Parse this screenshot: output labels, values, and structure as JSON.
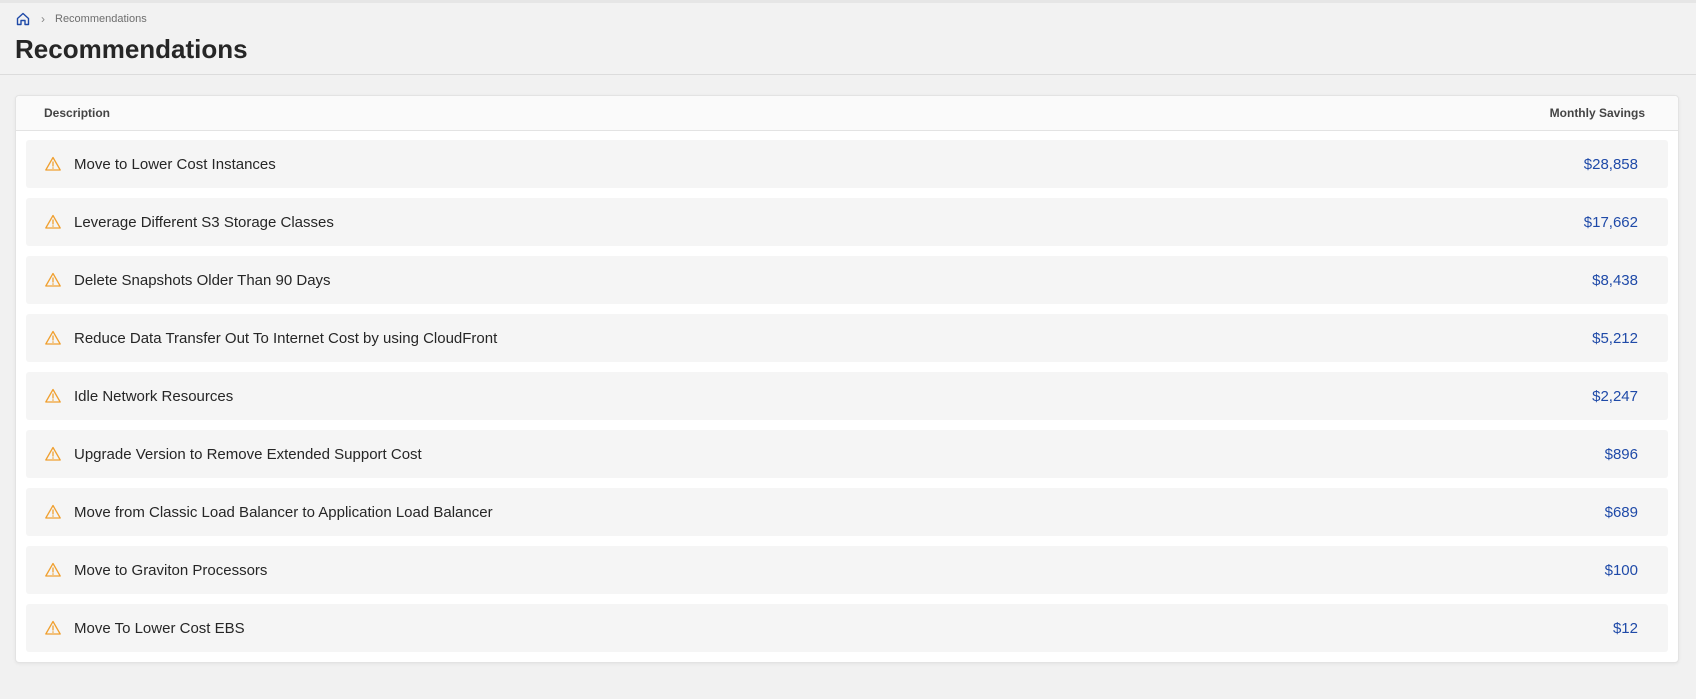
{
  "breadcrumb": {
    "current": "Recommendations"
  },
  "page": {
    "title": "Recommendations"
  },
  "table": {
    "columns": {
      "description": "Description",
      "savings": "Monthly Savings"
    },
    "rows": [
      {
        "description": "Move to Lower Cost Instances",
        "savings": "$28,858"
      },
      {
        "description": "Leverage Different S3 Storage Classes",
        "savings": "$17,662"
      },
      {
        "description": "Delete Snapshots Older Than 90 Days",
        "savings": "$8,438"
      },
      {
        "description": "Reduce Data Transfer Out To Internet Cost by using CloudFront",
        "savings": "$5,212"
      },
      {
        "description": "Idle Network Resources",
        "savings": "$2,247"
      },
      {
        "description": "Upgrade Version to Remove Extended Support Cost",
        "savings": "$896"
      },
      {
        "description": "Move from Classic Load Balancer to Application Load Balancer",
        "savings": "$689"
      },
      {
        "description": "Move to Graviton Processors",
        "savings": "$100"
      },
      {
        "description": "Move To Lower Cost EBS",
        "savings": "$12"
      }
    ]
  },
  "icons": {
    "home": "home-icon",
    "separator": "chevron-right-icon",
    "row": "warning-icon"
  },
  "colors": {
    "accent": "#1f4aa8",
    "warning": "#f0a030"
  }
}
